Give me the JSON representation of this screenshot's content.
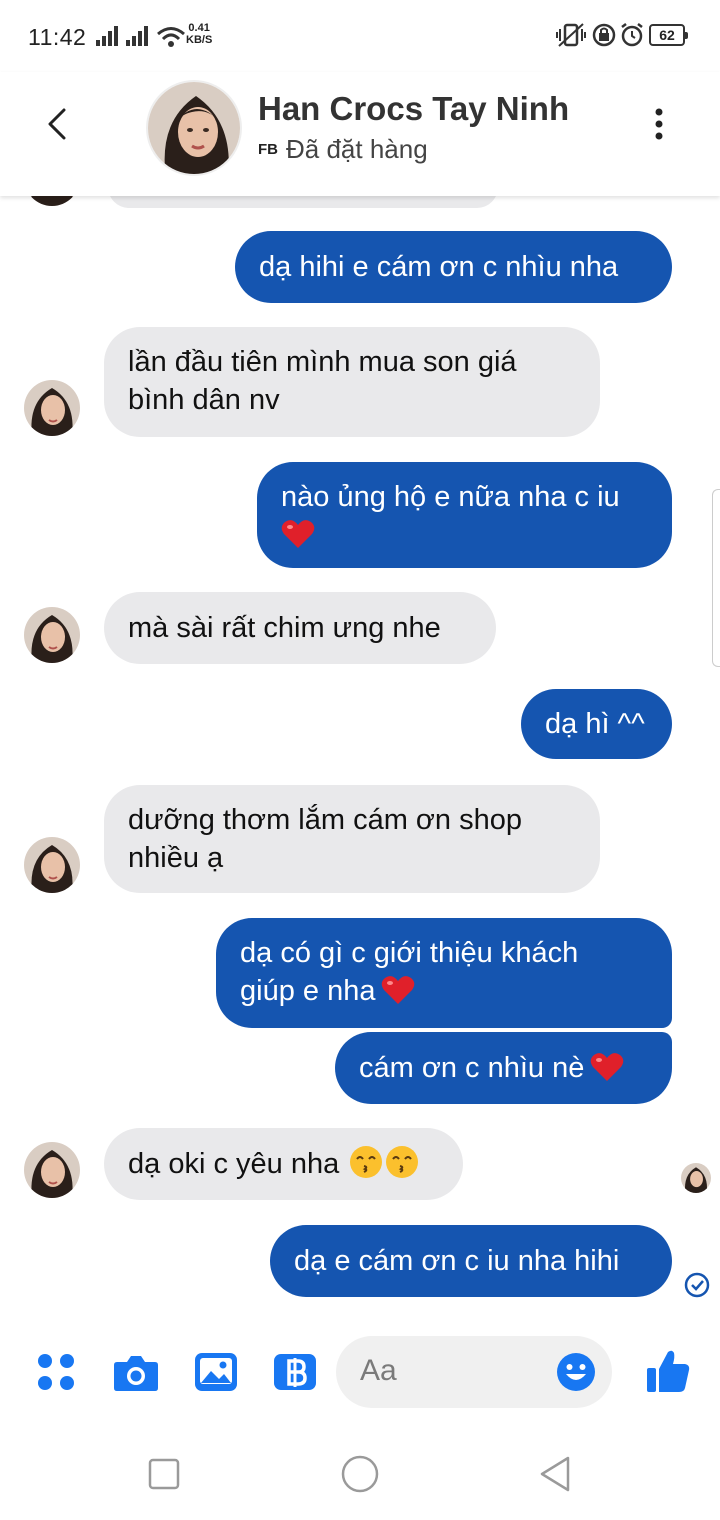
{
  "status_bar": {
    "time": "11:42",
    "net_speed_value": "0.41",
    "net_speed_unit": "KB/S",
    "battery": "62"
  },
  "header": {
    "contact_name": "Han Crocs Tay Ninh",
    "source_tag": "FB",
    "status": "Đã đặt hàng"
  },
  "messages": [
    {
      "side": "out",
      "lines": [
        "dạ hihi e cám ơn c nhìu nha"
      ]
    },
    {
      "side": "in",
      "lines": [
        "lần đầu tiên mình mua son giá",
        "bình dân nv"
      ]
    },
    {
      "side": "out",
      "lines": [
        "nào ủng hộ e nữa nha c iu",
        ""
      ],
      "emoji": "red-heart"
    },
    {
      "side": "in",
      "lines": [
        "mà sài rất chim ưng nhe"
      ]
    },
    {
      "side": "out",
      "lines": [
        "dạ hì ^^"
      ]
    },
    {
      "side": "in",
      "lines": [
        "dưỡng thơm lắm cám ơn shop",
        "nhiều ạ"
      ]
    },
    {
      "side": "out",
      "lines": [
        "dạ có gì c giới thiệu khách",
        "giúp e nha"
      ],
      "emoji": "red-heart"
    },
    {
      "side": "out",
      "lines": [
        "cám ơn c nhìu nè"
      ],
      "emoji": "red-heart"
    },
    {
      "side": "in",
      "lines": [
        "dạ oki c yêu nha"
      ],
      "emoji": "kissing-smiling-eyes"
    },
    {
      "side": "out",
      "lines": [
        "dạ e cám ơn c iu nha hihi"
      ],
      "status": "delivered"
    }
  ],
  "composer": {
    "placeholder": "Aa",
    "icons": [
      "menu-dots-icon",
      "camera-icon",
      "gallery-icon",
      "b-icon",
      "emoji-icon",
      "like-icon"
    ]
  },
  "colors": {
    "outgoing_bubble": "#1555b0",
    "incoming_bubble": "#e9e9eb",
    "accent": "#1877f2"
  }
}
